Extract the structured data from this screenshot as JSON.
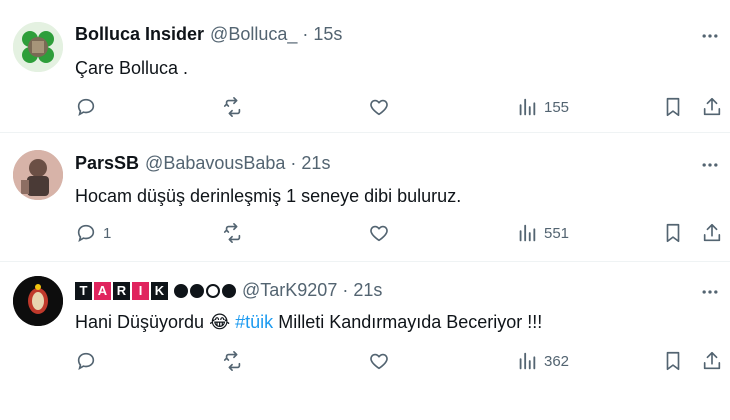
{
  "tweets": [
    {
      "name": "Bolluca Insider",
      "handle": "@Bolluca_",
      "time": "15s",
      "text": "Çare Bolluca .",
      "replies": "",
      "views": "155"
    },
    {
      "name": "ParsSB",
      "handle": "@BabavousBaba",
      "time": "21s",
      "text": "Hocam düşüş derinleşmiş 1 seneye dibi buluruz.",
      "replies": "1",
      "views": "551"
    },
    {
      "name_letters": [
        "T",
        "A",
        "R",
        "I",
        "K"
      ],
      "handle": "@TarK9207",
      "time": "21s",
      "text_before": "Hani Düşüyordu",
      "emoji": "😂",
      "hashtag": "#tüik",
      "text_after": "Milleti Kandırmayıda Beceriyor !!!",
      "replies": "",
      "views": "362"
    }
  ],
  "sep": "·",
  "icons": [
    "reply-icon",
    "retweet-icon",
    "like-icon",
    "views-icon",
    "bookmark-icon",
    "share-icon",
    "more-icon"
  ],
  "colors": {
    "text": "#0f1419",
    "secondary": "#536471",
    "link": "#1d9bf0",
    "divider": "#eff3f4"
  }
}
